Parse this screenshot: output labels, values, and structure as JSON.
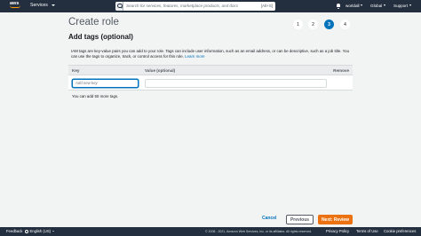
{
  "topnav": {
    "logo_text": "aws",
    "services_label": "Services",
    "search_placeholder": "Search for services, features, marketplace products, and docs",
    "search_shortcut": "[Alt+S]",
    "account_label": "worldall",
    "region_label": "Global",
    "support_label": "Support"
  },
  "page": {
    "title": "Create role",
    "steps": [
      "1",
      "2",
      "3",
      "4"
    ],
    "active_step": "3",
    "section_title": "Add tags (optional)",
    "description": "IAM tags are key-value pairs you can add to your role. Tags can include user information, such as an email address, or can be descriptive, such as a job title. You can use the tags to organize, track, or control access for this role.",
    "learn_more": "Learn more"
  },
  "tags_table": {
    "columns": [
      "Key",
      "Value (optional)",
      "Remove"
    ],
    "key_placeholder": "Add new key",
    "value_placeholder": "",
    "remaining_text": "You can add 50 more tags."
  },
  "actions": {
    "cancel": "Cancel",
    "previous": "Previous",
    "next": "Next: Review"
  },
  "footer": {
    "feedback": "Feedback",
    "language": "English (US)",
    "copyright": "© 2008 - 2021, Amazon Web Services, Inc. or its affiliates. All rights reserved.",
    "privacy": "Privacy Policy",
    "terms": "Terms of Use",
    "cookies": "Cookie preferences"
  },
  "colors": {
    "nav_bg": "#232f3e",
    "accent_orange": "#ec7211",
    "link_blue": "#0073bb"
  }
}
